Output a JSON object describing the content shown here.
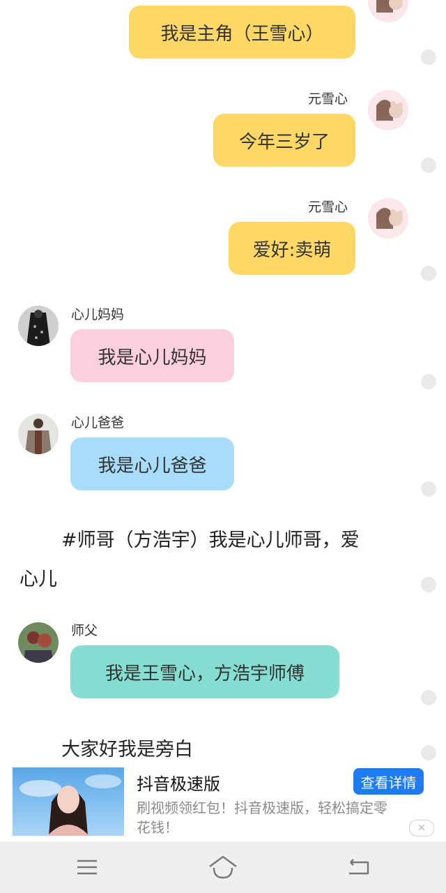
{
  "messages": {
    "m1": {
      "text": "我是主角（王雪心）"
    },
    "m2": {
      "name": "元雪心",
      "text": "今年三岁了"
    },
    "m3": {
      "name": "元雪心",
      "text": "爱好:卖萌"
    },
    "m4": {
      "name": "心儿妈妈",
      "text": "我是心儿妈妈"
    },
    "m5": {
      "name": "心儿爸爸",
      "text": "我是心儿爸爸"
    },
    "narr1": {
      "line1": "#师哥（方浩宇）我是心儿师哥，爱",
      "line2": "心儿"
    },
    "m6": {
      "name": "师父",
      "text": "我是王雪心，方浩宇师傅"
    },
    "narr2": {
      "text": "大家好我是旁白"
    }
  },
  "ad": {
    "title": "抖音极速版",
    "cta": "查看详情",
    "desc_line1": "刷视频领红包！抖音极速版，轻松搞定零",
    "desc_line2": "花钱！",
    "close": "✕"
  },
  "colors": {
    "yellow": "#fdd866",
    "pink": "#fbcfdb",
    "blue": "#a7dcfb",
    "teal": "#86ddd1",
    "cta": "#1e7cf2"
  },
  "icons": [
    "girl-avatar-icon",
    "mother-avatar-icon",
    "father-avatar-icon",
    "master-avatar-icon",
    "menu-icon",
    "home-icon",
    "back-icon",
    "close-icon"
  ]
}
